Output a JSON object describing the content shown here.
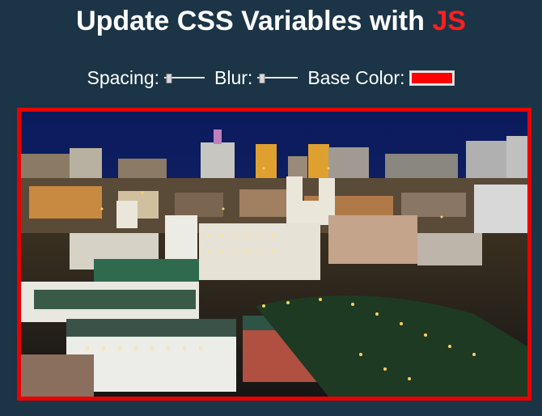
{
  "header": {
    "title_main": "Update CSS Variables with ",
    "title_highlight": "JS"
  },
  "controls": {
    "spacing": {
      "label": "Spacing:",
      "value_fraction": 0.05
    },
    "blur": {
      "label": "Blur:",
      "value_fraction": 0.05
    },
    "base_color": {
      "label": "Base Color:",
      "value": "#ff0000"
    }
  },
  "colors": {
    "page_background": "#1b3446",
    "accent": "#ff1f1f",
    "frame_border": "#e80000"
  },
  "image": {
    "subject": "night cityscape photograph"
  }
}
